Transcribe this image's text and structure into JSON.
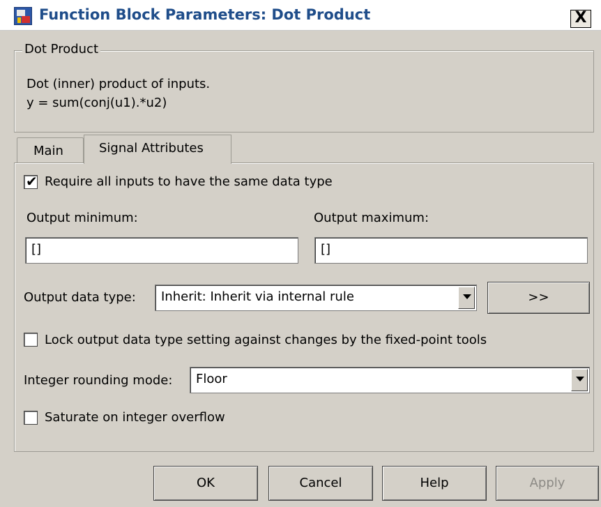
{
  "window": {
    "title": "Function Block Parameters: Dot Product",
    "close_label": "X"
  },
  "description": {
    "group_label": "Dot Product",
    "line1": "Dot (inner) product of inputs.",
    "line2": "y = sum(conj(u1).*u2)"
  },
  "tabs": [
    {
      "label": "Main",
      "selected": false
    },
    {
      "label": "Signal Attributes",
      "selected": true
    }
  ],
  "signal_attributes": {
    "require_same_type": {
      "label": "Require all inputs to have the same data type",
      "checked": true
    },
    "output_minimum": {
      "label": "Output minimum:",
      "value": "[]"
    },
    "output_maximum": {
      "label": "Output maximum:",
      "value": "[]"
    },
    "output_data_type": {
      "label": "Output data type:",
      "value": "Inherit: Inherit via internal rule",
      "assistant_label": ">>"
    },
    "lock_output": {
      "label": "Lock output data type setting against changes by the fixed-point tools",
      "checked": false
    },
    "rounding_mode": {
      "label": "Integer rounding mode:",
      "value": "Floor"
    },
    "saturate": {
      "label": "Saturate on integer overflow",
      "checked": false
    }
  },
  "buttons": {
    "ok": "OK",
    "cancel": "Cancel",
    "help": "Help",
    "apply": "Apply"
  }
}
